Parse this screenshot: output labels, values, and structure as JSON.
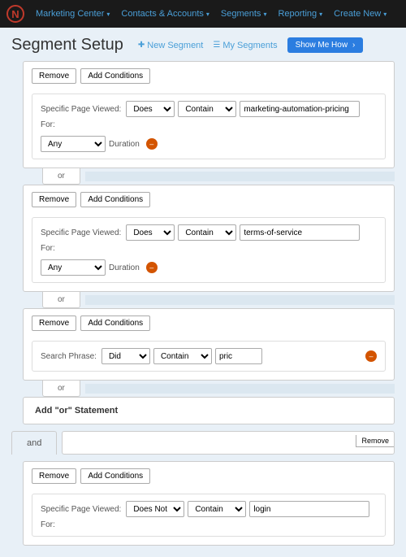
{
  "nav": {
    "logo": "N",
    "items": [
      "Marketing Center",
      "Contacts & Accounts",
      "Segments",
      "Reporting",
      "Create New"
    ]
  },
  "header": {
    "title": "Segment Setup",
    "new_segment": "New Segment",
    "my_segments": "My Segments",
    "show_me": "Show Me How"
  },
  "buttons": {
    "remove": "Remove",
    "add_conditions": "Add Conditions"
  },
  "labels": {
    "specific_page": "Specific Page Viewed:",
    "search_phrase": "Search Phrase:",
    "for": "For:",
    "duration": "Duration"
  },
  "selects": {
    "does": "Does",
    "does_not": "Does Not",
    "did": "Did",
    "contain": "Contain",
    "any": "Any"
  },
  "values": {
    "v1": "marketing-automation-pricing",
    "v2": "terms-of-service",
    "v3": "pric",
    "v4": "login"
  },
  "sep": {
    "or": "or",
    "and": "and",
    "add_or": "Add \"or\" Statement"
  }
}
